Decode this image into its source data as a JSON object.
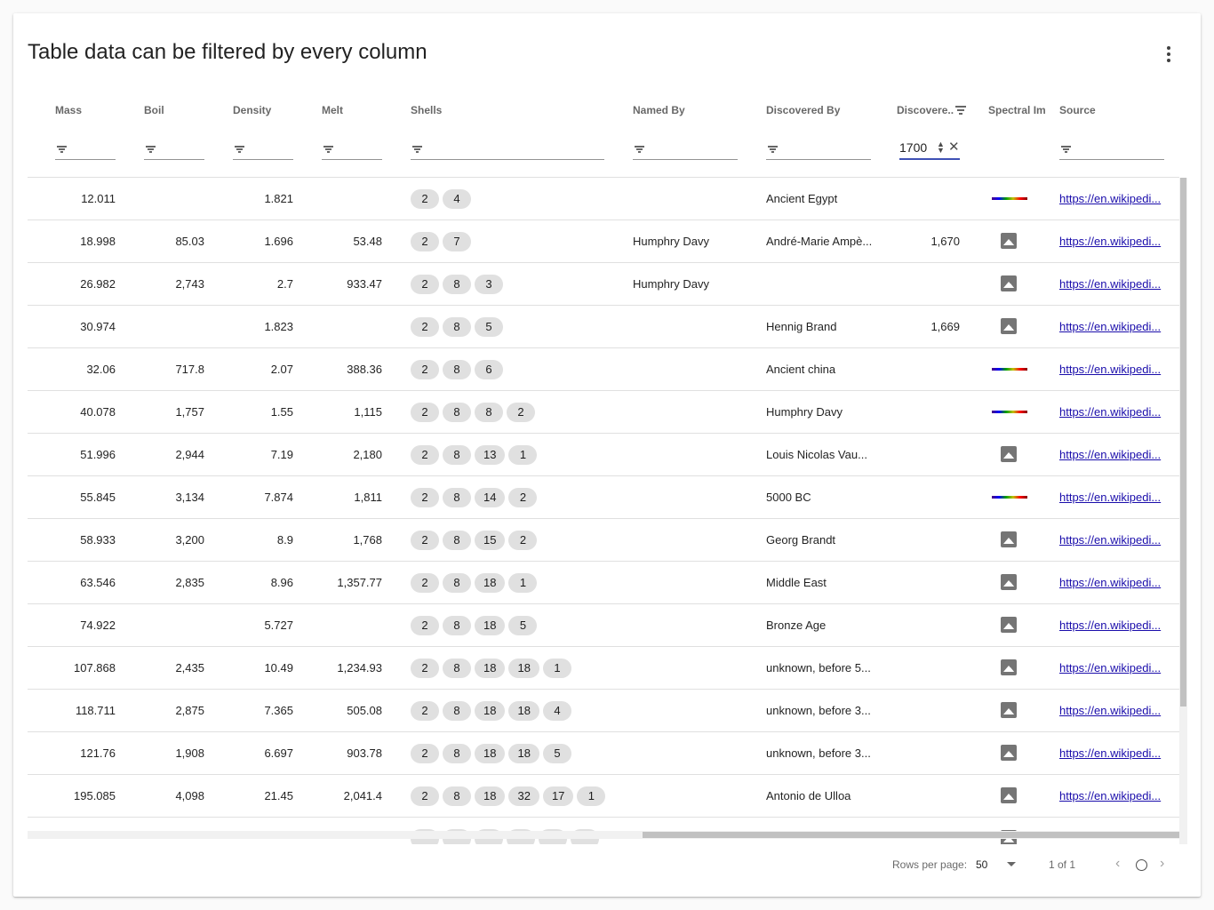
{
  "title": "Table data can be filtered by every column",
  "columns": {
    "mass": "Mass",
    "boil": "Boil",
    "density": "Density",
    "melt": "Melt",
    "shells": "Shells",
    "named_by": "Named By",
    "discovered_by": "Discovered By",
    "discovered_year": "Discovere...",
    "spectral": "Spectral Img",
    "source": "Source"
  },
  "filters": {
    "discovered_year_value": "1700"
  },
  "rows": [
    {
      "mass": "12.011",
      "boil": "",
      "density": "1.821",
      "melt": "",
      "shells": [
        "2",
        "4"
      ],
      "named_by": "",
      "discovered_by": "Ancient Egypt",
      "year": "",
      "spectral": "spectrum",
      "source": "https://en.wikipedi..."
    },
    {
      "mass": "18.998",
      "boil": "85.03",
      "density": "1.696",
      "melt": "53.48",
      "shells": [
        "2",
        "7"
      ],
      "named_by": "Humphry Davy",
      "discovered_by": "André-Marie Ampè...",
      "year": "1,670",
      "spectral": "image",
      "source": "https://en.wikipedi..."
    },
    {
      "mass": "26.982",
      "boil": "2,743",
      "density": "2.7",
      "melt": "933.47",
      "shells": [
        "2",
        "8",
        "3"
      ],
      "named_by": "Humphry Davy",
      "discovered_by": "",
      "year": "",
      "spectral": "image",
      "source": "https://en.wikipedi..."
    },
    {
      "mass": "30.974",
      "boil": "",
      "density": "1.823",
      "melt": "",
      "shells": [
        "2",
        "8",
        "5"
      ],
      "named_by": "",
      "discovered_by": "Hennig Brand",
      "year": "1,669",
      "spectral": "image",
      "source": "https://en.wikipedi..."
    },
    {
      "mass": "32.06",
      "boil": "717.8",
      "density": "2.07",
      "melt": "388.36",
      "shells": [
        "2",
        "8",
        "6"
      ],
      "named_by": "",
      "discovered_by": "Ancient china",
      "year": "",
      "spectral": "spectrum",
      "source": "https://en.wikipedi..."
    },
    {
      "mass": "40.078",
      "boil": "1,757",
      "density": "1.55",
      "melt": "1,115",
      "shells": [
        "2",
        "8",
        "8",
        "2"
      ],
      "named_by": "",
      "discovered_by": "Humphry Davy",
      "year": "",
      "spectral": "spectrum",
      "source": "https://en.wikipedi..."
    },
    {
      "mass": "51.996",
      "boil": "2,944",
      "density": "7.19",
      "melt": "2,180",
      "shells": [
        "2",
        "8",
        "13",
        "1"
      ],
      "named_by": "",
      "discovered_by": "Louis Nicolas Vau...",
      "year": "",
      "spectral": "image",
      "source": "https://en.wikipedi..."
    },
    {
      "mass": "55.845",
      "boil": "3,134",
      "density": "7.874",
      "melt": "1,811",
      "shells": [
        "2",
        "8",
        "14",
        "2"
      ],
      "named_by": "",
      "discovered_by": "5000 BC",
      "year": "",
      "spectral": "spectrum",
      "source": "https://en.wikipedi..."
    },
    {
      "mass": "58.933",
      "boil": "3,200",
      "density": "8.9",
      "melt": "1,768",
      "shells": [
        "2",
        "8",
        "15",
        "2"
      ],
      "named_by": "",
      "discovered_by": "Georg Brandt",
      "year": "",
      "spectral": "image",
      "source": "https://en.wikipedi..."
    },
    {
      "mass": "63.546",
      "boil": "2,835",
      "density": "8.96",
      "melt": "1,357.77",
      "shells": [
        "2",
        "8",
        "18",
        "1"
      ],
      "named_by": "",
      "discovered_by": "Middle East",
      "year": "",
      "spectral": "image",
      "source": "https://en.wikipedi..."
    },
    {
      "mass": "74.922",
      "boil": "",
      "density": "5.727",
      "melt": "",
      "shells": [
        "2",
        "8",
        "18",
        "5"
      ],
      "named_by": "",
      "discovered_by": "Bronze Age",
      "year": "",
      "spectral": "image",
      "source": "https://en.wikipedi..."
    },
    {
      "mass": "107.868",
      "boil": "2,435",
      "density": "10.49",
      "melt": "1,234.93",
      "shells": [
        "2",
        "8",
        "18",
        "18",
        "1"
      ],
      "named_by": "",
      "discovered_by": "unknown, before 5...",
      "year": "",
      "spectral": "image",
      "source": "https://en.wikipedi..."
    },
    {
      "mass": "118.711",
      "boil": "2,875",
      "density": "7.365",
      "melt": "505.08",
      "shells": [
        "2",
        "8",
        "18",
        "18",
        "4"
      ],
      "named_by": "",
      "discovered_by": "unknown, before 3...",
      "year": "",
      "spectral": "image",
      "source": "https://en.wikipedi..."
    },
    {
      "mass": "121.76",
      "boil": "1,908",
      "density": "6.697",
      "melt": "903.78",
      "shells": [
        "2",
        "8",
        "18",
        "18",
        "5"
      ],
      "named_by": "",
      "discovered_by": "unknown, before 3...",
      "year": "",
      "spectral": "image",
      "source": "https://en.wikipedi..."
    },
    {
      "mass": "195.085",
      "boil": "4,098",
      "density": "21.45",
      "melt": "2,041.4",
      "shells": [
        "2",
        "8",
        "18",
        "32",
        "17",
        "1"
      ],
      "named_by": "",
      "discovered_by": "Antonio de Ulloa",
      "year": "",
      "spectral": "image",
      "source": "https://en.wikipedi..."
    },
    {
      "mass": "",
      "boil": "",
      "density": "",
      "melt": "",
      "shells": [
        "",
        "",
        "",
        "",
        "",
        ""
      ],
      "named_by": "",
      "discovered_by": "",
      "year": "",
      "spectral": "image",
      "source": ""
    }
  ],
  "pagination": {
    "rows_per_page_label": "Rows per page:",
    "rows_per_page_value": "50",
    "page_info": "1 of 1",
    "prev": "‹",
    "next": "›"
  }
}
